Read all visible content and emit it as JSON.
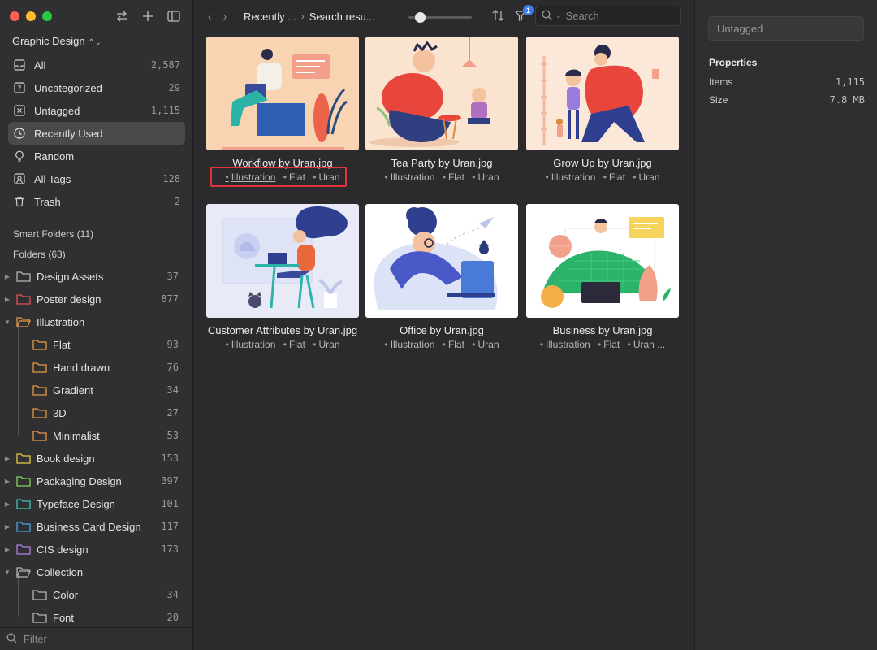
{
  "sidebar": {
    "library": "Graphic Design",
    "nav": [
      {
        "label": "All",
        "count": "2,587",
        "icon": "inbox-icon"
      },
      {
        "label": "Uncategorized",
        "count": "29",
        "icon": "question-box-icon"
      },
      {
        "label": "Untagged",
        "count": "1,115",
        "icon": "untagged-icon"
      },
      {
        "label": "Recently Used",
        "count": "",
        "icon": "clock-icon",
        "active": true
      },
      {
        "label": "Random",
        "count": "",
        "icon": "lightbulb-icon"
      },
      {
        "label": "All Tags",
        "count": "128",
        "icon": "tag-icon"
      },
      {
        "label": "Trash",
        "count": "2",
        "icon": "trash-icon"
      }
    ],
    "smart_folders": "Smart Folders (11)",
    "folders_head": "Folders (63)",
    "folders": [
      {
        "label": "Design Assets",
        "count": "37",
        "color": "#b5b5b5",
        "expanded": false
      },
      {
        "label": "Poster design",
        "count": "877",
        "color": "#e0525a",
        "expanded": false
      },
      {
        "label": "Illustration",
        "count": "",
        "color": "#e69a3f",
        "expanded": true
      },
      {
        "label": "Flat",
        "count": "93",
        "color": "#e69a3f",
        "child": true
      },
      {
        "label": "Hand drawn",
        "count": "76",
        "color": "#e69a3f",
        "child": true
      },
      {
        "label": "Gradient",
        "count": "34",
        "color": "#e69a3f",
        "child": true
      },
      {
        "label": "3D",
        "count": "27",
        "color": "#e69a3f",
        "child": true
      },
      {
        "label": "Minimalist",
        "count": "53",
        "color": "#e69a3f",
        "child": true
      },
      {
        "label": "Book design",
        "count": "153",
        "color": "#e6c93f",
        "expanded": false
      },
      {
        "label": "Packaging Design",
        "count": "397",
        "color": "#7fd45a",
        "expanded": false
      },
      {
        "label": "Typeface Design",
        "count": "101",
        "color": "#3fc7b8",
        "expanded": false
      },
      {
        "label": "Business Card Design",
        "count": "117",
        "color": "#4aa3e6",
        "expanded": false
      },
      {
        "label": "CIS design",
        "count": "173",
        "color": "#b07fe0",
        "expanded": false
      },
      {
        "label": "Collection",
        "count": "",
        "color": "#b5b5b5",
        "expanded": true
      },
      {
        "label": "Color",
        "count": "34",
        "color": "#b5b5b5",
        "child": true
      },
      {
        "label": "Font",
        "count": "20",
        "color": "#b5b5b5",
        "child": true
      }
    ],
    "filter_placeholder": "Filter"
  },
  "toolbar": {
    "crumb1": "Recently ...",
    "crumb2": "Search resu...",
    "filter_badge": "1",
    "search_placeholder": "Search"
  },
  "grid": [
    {
      "title": "Workflow by Uran.jpg",
      "tags": [
        "Illustration",
        "Flat",
        "Uran"
      ]
    },
    {
      "title": "Tea Party by Uran.jpg",
      "tags": [
        "Illustration",
        "Flat",
        "Uran"
      ]
    },
    {
      "title": "Grow Up by Uran.jpg",
      "tags": [
        "Illustration",
        "Flat",
        "Uran"
      ]
    },
    {
      "title": "Customer Attributes by Uran.jpg",
      "tags": [
        "Illustration",
        "Flat",
        "Uran"
      ]
    },
    {
      "title": "Office by Uran.jpg",
      "tags": [
        "Illustration",
        "Flat",
        "Uran"
      ]
    },
    {
      "title": "Business by Uran.jpg",
      "tags": [
        "Illustration",
        "Flat",
        "Uran ..."
      ]
    }
  ],
  "inspector": {
    "tag_placeholder": "Untagged",
    "properties_title": "Properties",
    "items_label": "Items",
    "items_value": "1,115",
    "size_label": "Size",
    "size_value": "7.8 MB"
  },
  "colors": {
    "accent": "#3d7bf0",
    "highlight": "#e0333a"
  }
}
